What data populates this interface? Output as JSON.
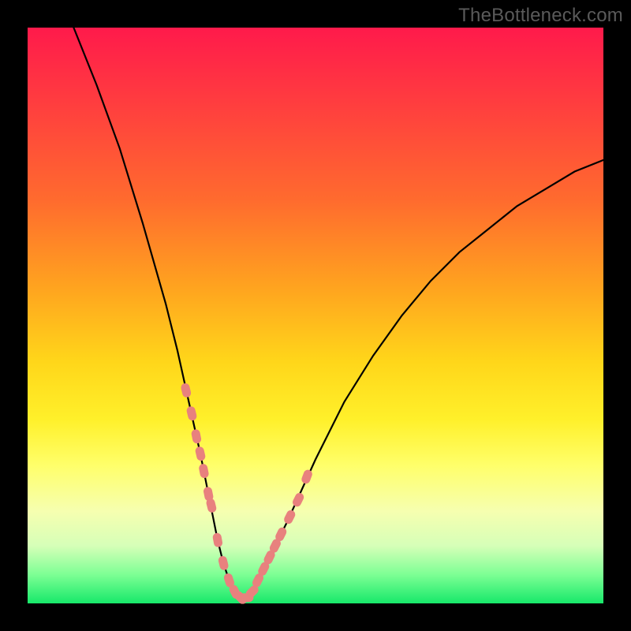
{
  "watermark": "TheBottleneck.com",
  "chart_data": {
    "type": "line",
    "title": "",
    "xlabel": "",
    "ylabel": "",
    "xlim": [
      0,
      100
    ],
    "ylim": [
      0,
      100
    ],
    "series": [
      {
        "name": "bottleneck-curve",
        "x": [
          8,
          12,
          16,
          20,
          24,
          26,
          28,
          30,
          31,
          32,
          33,
          34,
          35,
          36,
          37,
          38,
          39,
          40,
          42,
          45,
          50,
          55,
          60,
          65,
          70,
          75,
          80,
          85,
          90,
          95,
          100
        ],
        "y": [
          100,
          90,
          79,
          66,
          52,
          44,
          35,
          26,
          21,
          16,
          11,
          7,
          4,
          2,
          1,
          1,
          2,
          4,
          8,
          14,
          25,
          35,
          43,
          50,
          56,
          61,
          65,
          69,
          72,
          75,
          77
        ]
      }
    ],
    "markers": {
      "name": "data-points",
      "x": [
        27.5,
        28.5,
        29.3,
        30.0,
        30.6,
        31.4,
        31.9,
        33.0,
        34.0,
        35.0,
        36.0,
        37.0,
        38.0,
        39.0,
        40.0,
        41.0,
        42.0,
        43.0,
        44.0,
        45.5,
        47.0,
        48.5
      ],
      "y": [
        37,
        33,
        29,
        26,
        23,
        19,
        17,
        11,
        7,
        4,
        2,
        1,
        1,
        2,
        4,
        6,
        8,
        10,
        12,
        15,
        18,
        22
      ]
    },
    "colors": {
      "curve": "#000000",
      "marker": "#e8817e",
      "background_top": "#ff1a4b",
      "background_bottom": "#17e86a"
    }
  }
}
